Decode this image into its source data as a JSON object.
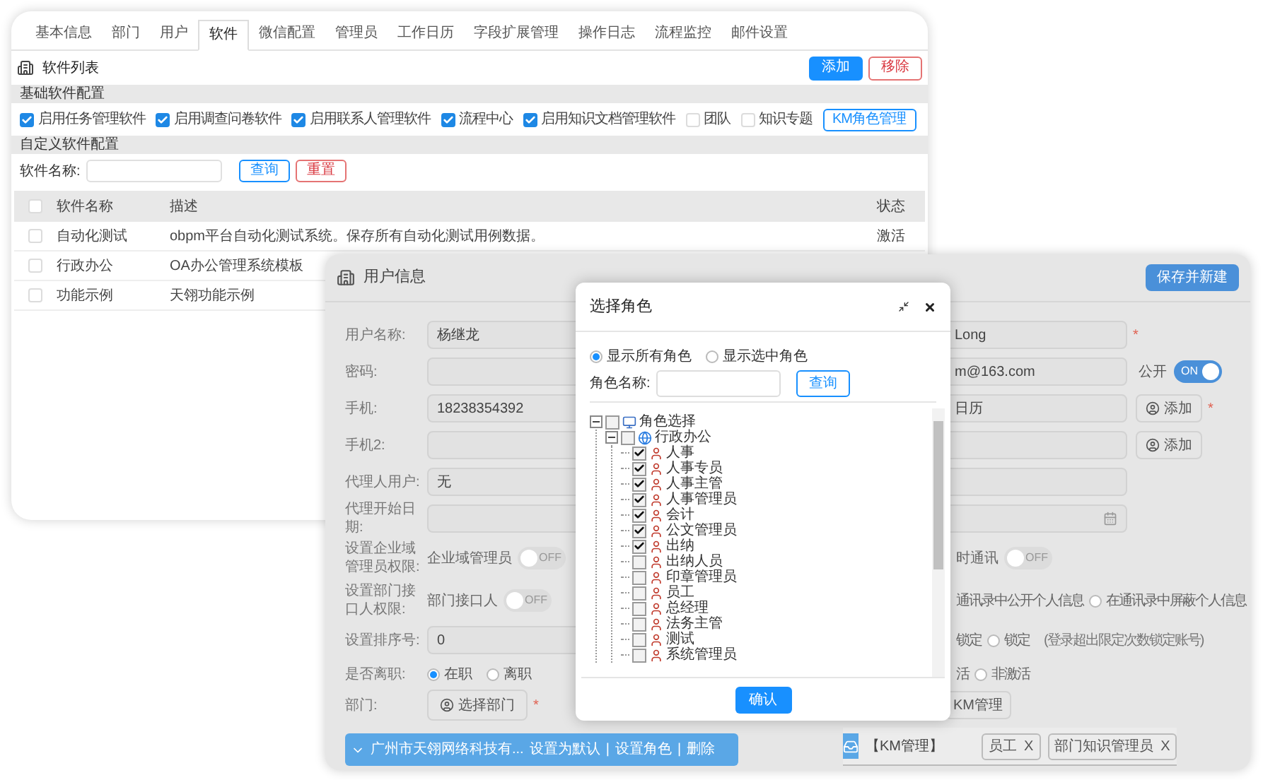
{
  "software_window": {
    "tabs": [
      {
        "label": "基本信息",
        "selected": false
      },
      {
        "label": "部门",
        "selected": false
      },
      {
        "label": "用户",
        "selected": false
      },
      {
        "label": "软件",
        "selected": true
      },
      {
        "label": "微信配置",
        "selected": false
      },
      {
        "label": "管理员",
        "selected": false
      },
      {
        "label": "工作日历",
        "selected": false
      },
      {
        "label": "字段扩展管理",
        "selected": false
      },
      {
        "label": "操作日志",
        "selected": false
      },
      {
        "label": "流程监控",
        "selected": false
      },
      {
        "label": "邮件设置",
        "selected": false
      }
    ],
    "title": "软件列表",
    "actions": [
      {
        "label": "添加",
        "kind": "primary"
      },
      {
        "label": "移除",
        "kind": "danger"
      }
    ],
    "basic_config": {
      "title": "基础软件配置",
      "options": [
        {
          "label": "启用任务管理软件",
          "checked": true
        },
        {
          "label": "启用调查问卷软件",
          "checked": true
        },
        {
          "label": "启用联系人管理软件",
          "checked": true
        },
        {
          "label": "流程中心",
          "checked": true
        },
        {
          "label": "启用知识文档管理软件",
          "checked": true
        },
        {
          "label": "团队",
          "checked": false
        },
        {
          "label": "知识专题",
          "checked": false
        }
      ],
      "button": "KM角色管理"
    },
    "custom_config": {
      "title": "自定义软件配置",
      "search_label": "软件名称:",
      "buttons": [
        {
          "label": "查询",
          "kind": "outline"
        },
        {
          "label": "重置",
          "kind": "danger"
        }
      ]
    },
    "table": {
      "header_checked": false,
      "columns": [
        "软件名称",
        "描述",
        "状态"
      ],
      "rows": [
        {
          "checked": false,
          "name": "自动化测试",
          "description": "obpm平台自动化测试系统。保存所有自动化测试用例数据。",
          "status": "激活"
        },
        {
          "checked": false,
          "name": "行政办公",
          "description": "OA办公管理系统模板"
        },
        {
          "checked": false,
          "name": "功能示例",
          "description": "天翎功能示例"
        }
      ]
    }
  },
  "user_window": {
    "title": "用户信息",
    "save_button": "保存并新建",
    "rows": [
      {
        "left": {
          "kind": "field",
          "label": "用户名称:",
          "value": "杨继龙"
        },
        "right": {
          "kind": "field",
          "value": "Long",
          "required": "*"
        }
      },
      {
        "left": {
          "kind": "field",
          "label": "密码:"
        },
        "right": {
          "kind": "field",
          "value": "m@163.com",
          "switch": {
            "label": "公开",
            "on": true,
            "text": "ON"
          }
        }
      },
      {
        "left": {
          "kind": "field",
          "label": "手机:",
          "value": "18238354392"
        },
        "right": {
          "kind": "field",
          "value": "日历",
          "button": "添加",
          "required": "*"
        }
      },
      {
        "left": {
          "kind": "field",
          "label": "手机2:"
        },
        "right": {
          "kind": "field",
          "button": "添加"
        }
      },
      {
        "left": {
          "kind": "field",
          "label": "代理人用户:",
          "value": "无"
        },
        "right": {
          "kind": "field"
        }
      },
      {
        "left": {
          "kind": "field",
          "label": "代理开始日期:"
        },
        "right": {
          "kind": "date"
        }
      },
      {
        "left": {
          "kind": "switch",
          "label": "设置企业域管理员权限:",
          "text": "企业域管理员",
          "on": false,
          "switch_text": "OFF"
        },
        "right": {
          "kind": "switch",
          "text": "时通讯",
          "on": false,
          "switch_text": "OFF"
        }
      },
      {
        "left": {
          "kind": "switch",
          "label": "设置部门接口人权限:",
          "text": "部门接口人",
          "on": false,
          "switch_text": "OFF"
        },
        "right": {
          "kind": "radio",
          "lead": "通讯录中公开个人信息",
          "options": [
            {
              "label": "在通讯录中屏蔽个人信息",
              "selected": false
            }
          ]
        }
      },
      {
        "left": {
          "kind": "field",
          "label": "设置排序号:",
          "value": "0"
        },
        "right": {
          "kind": "radio",
          "lead": "锁定",
          "options": [
            {
              "label": "锁定",
              "selected": false
            }
          ],
          "note": "(登录超出限定次数锁定账号)"
        }
      },
      {
        "left": {
          "kind": "radio",
          "label": "是否离职:",
          "options": [
            {
              "label": "在职",
              "selected": true
            },
            {
              "label": "离职",
              "selected": false
            }
          ]
        },
        "right": {
          "kind": "radio",
          "lead": "活",
          "options": [
            {
              "label": "非激活",
              "selected": false
            }
          ]
        }
      },
      {
        "left": {
          "kind": "button",
          "label": "部门:",
          "button": "选择部门",
          "required": "*"
        },
        "right": {
          "kind": "button",
          "button": "KM管理"
        }
      }
    ],
    "department_bar": {
      "name": "广州市天翎网络科技有...",
      "links": [
        "设置为默认",
        "设置角色",
        "删除"
      ],
      "separator": "|"
    },
    "km_bar": {
      "title": "【KM管理】",
      "tags": [
        {
          "label": "员工",
          "remove": "X"
        },
        {
          "label": "部门知识管理员",
          "remove": "X"
        }
      ]
    }
  },
  "role_dialog": {
    "title": "选择角色",
    "filters": [
      {
        "label": "显示所有角色",
        "selected": true
      },
      {
        "label": "显示选中角色",
        "selected": false
      }
    ],
    "search_label": "角色名称:",
    "search_button": "查询",
    "tree": [
      {
        "label": "角色选择",
        "kind": "root",
        "checked": false,
        "expanded": true,
        "children": [
          {
            "label": "行政办公",
            "kind": "group",
            "checked": false,
            "expanded": true,
            "children": [
              {
                "label": "人事",
                "kind": "role",
                "checked": true
              },
              {
                "label": "人事专员",
                "kind": "role",
                "checked": true
              },
              {
                "label": "人事主管",
                "kind": "role",
                "checked": true
              },
              {
                "label": "人事管理员",
                "kind": "role",
                "checked": true
              },
              {
                "label": "会计",
                "kind": "role",
                "checked": true
              },
              {
                "label": "公文管理员",
                "kind": "role",
                "checked": true
              },
              {
                "label": "出纳",
                "kind": "role",
                "checked": true
              },
              {
                "label": "出纳人员",
                "kind": "role",
                "checked": false
              },
              {
                "label": "印章管理员",
                "kind": "role",
                "checked": false
              },
              {
                "label": "员工",
                "kind": "role",
                "checked": false
              },
              {
                "label": "总经理",
                "kind": "role",
                "checked": false
              },
              {
                "label": "法务主管",
                "kind": "role",
                "checked": false
              },
              {
                "label": "测试",
                "kind": "role",
                "checked": false
              },
              {
                "label": "系统管理员",
                "kind": "role",
                "checked": false
              }
            ]
          }
        ]
      }
    ],
    "confirm": "确认"
  }
}
